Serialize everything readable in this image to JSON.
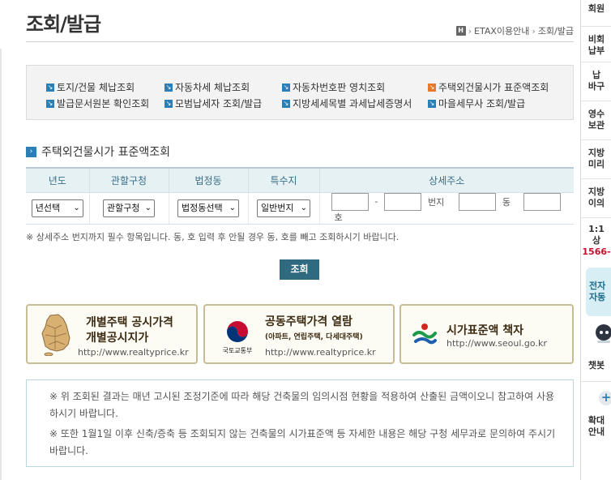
{
  "header": {
    "title": "조회/발급",
    "breadcrumb": [
      "ETAX이용안내",
      "조회/발급"
    ]
  },
  "quick_links": [
    {
      "label": "토지/건물 체납조회",
      "highlight": false
    },
    {
      "label": "자동차세 체납조회",
      "highlight": false
    },
    {
      "label": "자동차번호판 영치조회",
      "highlight": false
    },
    {
      "label": "주택외건물시가 표준액조회",
      "highlight": true
    },
    {
      "label": "발급문서원본 확인조회",
      "highlight": false
    },
    {
      "label": "모범납세자 조회/발급",
      "highlight": false
    },
    {
      "label": "지방세세목별 과세납세증명서",
      "highlight": false
    },
    {
      "label": "마을세무사 조회/발급",
      "highlight": false
    }
  ],
  "section": {
    "title": "주택외건물시가 표준액조회"
  },
  "table": {
    "headers": [
      "년도",
      "관할구청",
      "법정동",
      "특수지",
      "상세주소"
    ],
    "selects": {
      "year": "년선택",
      "district": "관할구청",
      "dong": "법정동선택",
      "special": "일반번지"
    },
    "address_labels": {
      "dash": "-",
      "bunji": "번지",
      "dong": "동",
      "ho": "호"
    }
  },
  "note": "※ 상세주소 번지까지 필수 항목입니다. 동, 호 입력 후 안될 경우 동, 호를 빼고 조회하시기 바랍니다.",
  "search_button": "조회",
  "banners": [
    {
      "title": "개별주택 공시가격",
      "title2": "개별공시지가",
      "url": "http://www.realtyprice.kr"
    },
    {
      "title": "공동주택가격 열람",
      "subtitle": "(아파트, 연립주택, 다세대주택)",
      "org": "국토교통부",
      "url": "http://www.realtyprice.kr"
    },
    {
      "title": "시가표준액 책자",
      "url": "http://www.seoul.go.kr"
    }
  ],
  "info": [
    "※ 위 조회된 결과는 매년 고시된 조정기준에 따라 해당 건축물의 임의시점 현황을 적용하여 산출된 금액이오니 참고하여 사용하시기 바랍니다.",
    "※ 또한 1월1일 이후 신축/증축 등 조회되지 않는 건축물의 시가표준액 등 자세한 내용은 해당 구청 세무과로 문의하여 주시기 바랍니다."
  ],
  "sidebar": [
    {
      "label": "회원"
    },
    {
      "label": "비회",
      "label2": "납부"
    },
    {
      "label": "납",
      "label2": "바구"
    },
    {
      "label": "영수",
      "label2": "보관"
    },
    {
      "label": "지방",
      "label2": "미리"
    },
    {
      "label": "지방",
      "label2": "이의"
    },
    {
      "label": "1:1 ",
      "label2": "상",
      "phone": "1566-"
    },
    {
      "label": "전자",
      "label2": "자동"
    },
    {
      "label": "챗봇"
    },
    {
      "label": "확대",
      "label2": "안내"
    }
  ],
  "colors": {
    "accent": "#2c7fb5",
    "highlight": "#e8792c",
    "button": "#2f6a80",
    "table_header_bg": "#e6f1f4",
    "banner_border": "#c8bc95"
  }
}
